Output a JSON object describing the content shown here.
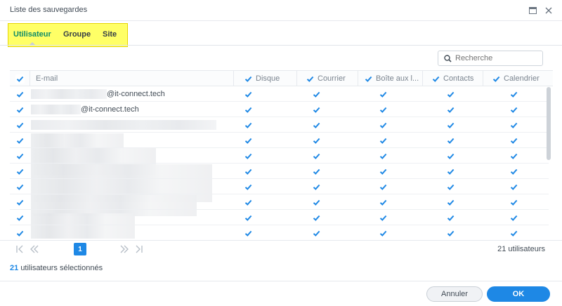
{
  "window": {
    "title": "Liste des sauvegardes"
  },
  "tabs": [
    {
      "label": "Utilisateur",
      "active": true
    },
    {
      "label": "Groupe",
      "active": false
    },
    {
      "label": "Site",
      "active": false
    }
  ],
  "search": {
    "placeholder": "Recherche",
    "value": ""
  },
  "table": {
    "columns": [
      "E-mail",
      "Disque",
      "Courrier",
      "Boîte aux l...",
      "Contacts",
      "Calendrier"
    ],
    "header_checked": [
      true,
      true,
      true,
      true,
      true,
      true
    ],
    "rows": [
      {
        "email_suffix": "@it-connect.tech",
        "checked": true
      },
      {
        "email_suffix": "@it-connect.tech",
        "checked": true
      },
      {
        "email_suffix": "",
        "checked": true
      },
      {
        "email_suffix": "",
        "checked": true
      },
      {
        "email_suffix": "",
        "checked": true
      },
      {
        "email_suffix": "",
        "checked": true
      },
      {
        "email_suffix": "",
        "checked": true
      },
      {
        "email_suffix": "",
        "checked": true
      },
      {
        "email_suffix": "",
        "checked": true
      },
      {
        "email_suffix": "",
        "checked": true
      }
    ]
  },
  "pagination": {
    "current_page": "1",
    "total_label": "21 utilisateurs"
  },
  "selection": {
    "count": "21",
    "label": "utilisateurs sélectionnés"
  },
  "buttons": {
    "cancel": "Annuler",
    "ok": "OK"
  },
  "colors": {
    "accent": "#1e88e5",
    "active_tab": "#0f8c69",
    "highlight": "#ffff66"
  },
  "icons": {
    "maximize": "maximize-icon",
    "close": "close-icon",
    "search": "search-icon",
    "checkbox": "checkmark-icon",
    "first": "first-page-icon",
    "prev": "previous-page-icon",
    "next": "next-page-icon",
    "last": "last-page-icon"
  }
}
